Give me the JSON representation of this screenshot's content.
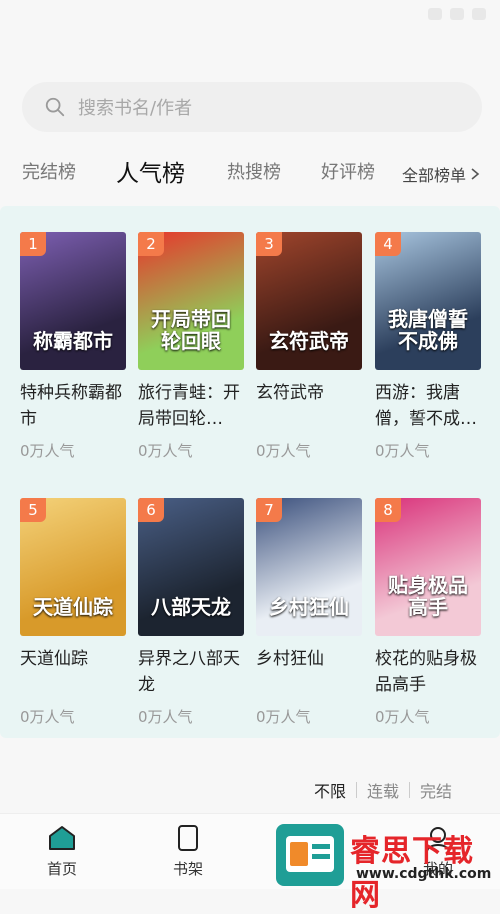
{
  "search": {
    "placeholder": "搜索书名/作者"
  },
  "tabs": [
    {
      "label": "完结榜"
    },
    {
      "label": "人气榜"
    },
    {
      "label": "热搜榜"
    },
    {
      "label": "好评榜"
    }
  ],
  "all_lists": {
    "label": "全部榜单"
  },
  "books": [
    {
      "rank": "1",
      "title": "特种兵称霸都市",
      "popularity": "0万人气",
      "cover_text": "称霸都市",
      "cover_bg": "#2a2240",
      "cover_accent": "#7d5fb2"
    },
    {
      "rank": "2",
      "title": "旅行青蛙：开局带回轮…",
      "popularity": "0万人气",
      "cover_text": "开局带回轮回眼",
      "cover_bg": "#8fcf5a",
      "cover_accent": "#e8352c"
    },
    {
      "rank": "3",
      "title": "玄符武帝",
      "popularity": "0万人气",
      "cover_text": "玄符武帝",
      "cover_bg": "#3a1a14",
      "cover_accent": "#a0452c"
    },
    {
      "rank": "4",
      "title": "西游：我唐僧，誓不成…",
      "popularity": "0万人气",
      "cover_text": "我唐僧誓不成佛",
      "cover_bg": "#2c3f5c",
      "cover_accent": "#a9c6e0"
    },
    {
      "rank": "5",
      "title": "天道仙踪",
      "popularity": "0万人气",
      "cover_text": "天道仙踪",
      "cover_bg": "#d89a2a",
      "cover_accent": "#f4d27a"
    },
    {
      "rank": "6",
      "title": "异界之八部天龙",
      "popularity": "0万人气",
      "cover_text": "八部天龙",
      "cover_bg": "#1c2430",
      "cover_accent": "#4a5f86"
    },
    {
      "rank": "7",
      "title": "乡村狂仙",
      "popularity": "0万人气",
      "cover_text": "乡村狂仙",
      "cover_bg": "#e9eef4",
      "cover_accent": "#3a4f7c"
    },
    {
      "rank": "8",
      "title": "校花的贴身极品高手",
      "popularity": "0万人气",
      "cover_text": "贴身极品高手",
      "cover_bg": "#f3c9d6",
      "cover_accent": "#d9317a"
    }
  ],
  "filters": [
    "不限",
    "连载",
    "完结"
  ],
  "bottom_nav": [
    {
      "label": "首页",
      "icon": "home-icon"
    },
    {
      "label": "书架",
      "icon": "bookshelf-icon"
    },
    {
      "label": "我的",
      "icon": "profile-icon"
    }
  ],
  "watermark": {
    "name": "睿思下载网",
    "url": "www.cdgthk.com"
  },
  "colors": {
    "accent_rank": "#f47a4a",
    "panel_bg": "#e9f5f4",
    "nav_active": "#1f9e96"
  }
}
